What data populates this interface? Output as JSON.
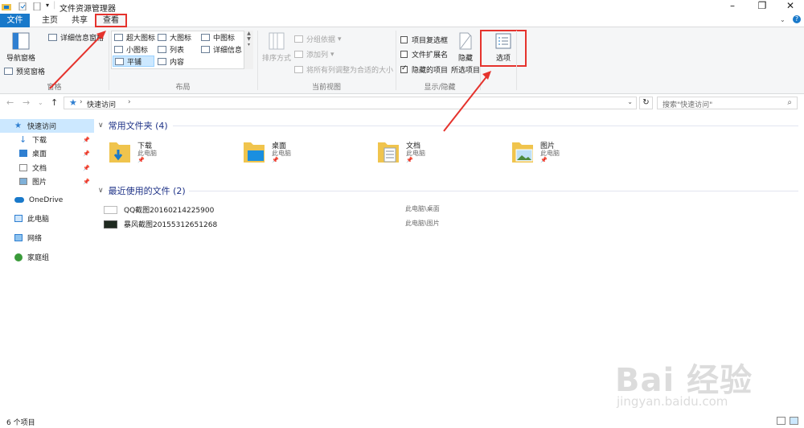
{
  "window": {
    "title": "文件资源管理器",
    "controls": {
      "minimize": "–",
      "maximize": "❐",
      "close": "✕"
    }
  },
  "tabs": [
    {
      "label": "文件"
    },
    {
      "label": "主页"
    },
    {
      "label": "共享"
    },
    {
      "label": "查看"
    }
  ],
  "ribbon": {
    "pane": {
      "nav_pane": "导航窗格",
      "preview_pane": "预览窗格",
      "details_pane": "详细信息窗格",
      "group_label": "窗格"
    },
    "layout": {
      "items": [
        "超大图标",
        "大图标",
        "中图标",
        "小图标",
        "列表",
        "详细信息",
        "平铺",
        "内容"
      ],
      "selected": "平铺",
      "group_label": "布局"
    },
    "current_view": {
      "sort_by": "排序方式",
      "group_by": "分组依据",
      "add_columns": "添加列",
      "size_all_columns": "将所有列调整为合适的大小",
      "group_label": "当前视图"
    },
    "show_hide": {
      "item_checkboxes": "项目复选框",
      "file_extensions": "文件扩展名",
      "hidden_items": "隐藏的项目",
      "hide_selected_top": "隐藏",
      "hide_selected_bottom": "所选项目",
      "group_label": "显示/隐藏"
    },
    "options": {
      "label": "选项"
    }
  },
  "address": {
    "crumb": "快速访问",
    "search_placeholder": "搜索\"快速访问\""
  },
  "nav": {
    "quick_access": "快速访问",
    "downloads": "下载",
    "desktop": "桌面",
    "documents": "文档",
    "pictures": "图片",
    "onedrive": "OneDrive",
    "this_pc": "此电脑",
    "network": "网络",
    "homegroup": "家庭组"
  },
  "content": {
    "frequent_header": "常用文件夹 (4)",
    "recent_header": "最近使用的文件 (2)",
    "folders": [
      {
        "name": "下载",
        "location": "此电脑"
      },
      {
        "name": "桌面",
        "location": "此电脑"
      },
      {
        "name": "文档",
        "location": "此电脑"
      },
      {
        "name": "图片",
        "location": "此电脑"
      }
    ],
    "recent_files": [
      {
        "name": "QQ截图20160214225900",
        "location": "此电脑\\桌面"
      },
      {
        "name": "暴风截图20155312651268",
        "location": "此电脑\\图片"
      }
    ]
  },
  "status": {
    "item_count": "6 个项目"
  },
  "watermark": {
    "logo": "Bai 经验",
    "url": "jingyan.baidu.com"
  },
  "colors": {
    "accent": "#1979ca",
    "highlight": "#e5332d",
    "folder": "#f0c44d",
    "selected_nav": "#cce8ff"
  }
}
